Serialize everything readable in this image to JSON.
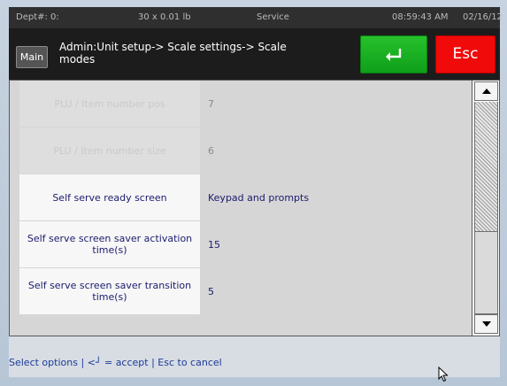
{
  "status_bar": {
    "dept": "Dept#: 0:",
    "weight": "30 x 0.01 lb",
    "mode": "Service",
    "time": "08:59:43 AM",
    "date": "02/16/12"
  },
  "header": {
    "main_label": "Main",
    "breadcrumb": "Admin:Unit setup-> Scale settings-> Scale modes",
    "esc_label": "Esc"
  },
  "settings": [
    {
      "label": "PLU / Item number pos",
      "value": "7",
      "enabled": false
    },
    {
      "label": "PLU / Item number size",
      "value": "6",
      "enabled": false
    },
    {
      "label": "Self serve ready screen",
      "value": "Keypad and prompts",
      "enabled": true
    },
    {
      "label": "Self serve screen saver activation time(s)",
      "value": "15",
      "enabled": true
    },
    {
      "label": "Self serve screen saver transition time(s)",
      "value": "5",
      "enabled": true
    }
  ],
  "footer": {
    "hint": "Select options | <┘ = accept | Esc to cancel"
  },
  "colors": {
    "enter_button": "#19b120",
    "esc_button": "#f00a0a",
    "label_text": "#1b1b6e",
    "hint_text": "#1b3a9a"
  },
  "icons": {
    "enter": "return-arrow-icon",
    "scroll_up": "triangle-up-icon",
    "scroll_down": "triangle-down-icon",
    "cursor": "mouse-pointer-icon"
  }
}
